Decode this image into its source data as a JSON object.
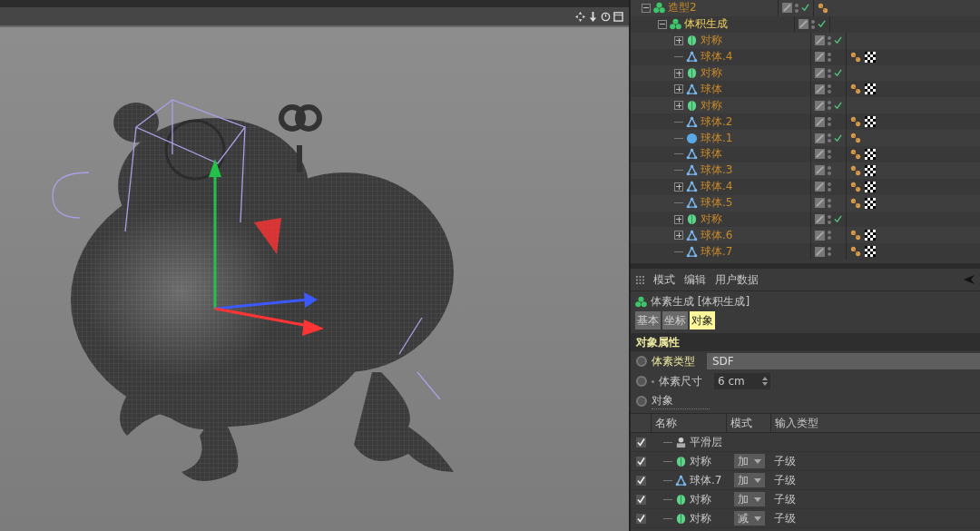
{
  "object_manager": {
    "tree": [
      {
        "name": "造型2",
        "kind": "cloner",
        "expanded": true,
        "enabled": true,
        "selected": false,
        "phong_tag": true,
        "texture_tag": false,
        "children": [
          {
            "name": "体积生成",
            "kind": "cloner",
            "expanded": true,
            "enabled": true,
            "selected": true,
            "phong_tag": false,
            "texture_tag": false,
            "children": [
              {
                "name": "对称",
                "kind": "symmetry",
                "expanded": false,
                "enabled": true,
                "selected": false,
                "phong_tag": false,
                "texture_tag": false
              },
              {
                "name": "球体.4",
                "kind": "polygon",
                "enabled": false,
                "selected": false,
                "phong_tag": true,
                "texture_tag": true
              },
              {
                "name": "对称",
                "kind": "symmetry",
                "expanded": false,
                "enabled": true,
                "selected": false,
                "phong_tag": false,
                "texture_tag": false
              },
              {
                "name": "球体",
                "kind": "polygon",
                "expanded": false,
                "enabled": false,
                "selected": false,
                "phong_tag": true,
                "texture_tag": true
              },
              {
                "name": "对称",
                "kind": "symmetry",
                "expanded": false,
                "enabled": true,
                "selected": false,
                "phong_tag": false,
                "texture_tag": false
              },
              {
                "name": "球体.2",
                "kind": "polygon",
                "enabled": false,
                "selected": false,
                "phong_tag": true,
                "texture_tag": true
              },
              {
                "name": "球体.1",
                "kind": "sphere",
                "enabled": true,
                "selected": false,
                "phong_tag": true,
                "texture_tag": false
              },
              {
                "name": "球体",
                "kind": "polygon",
                "enabled": false,
                "selected": false,
                "phong_tag": true,
                "texture_tag": true
              },
              {
                "name": "球体.3",
                "kind": "polygon",
                "enabled": false,
                "selected": false,
                "phong_tag": true,
                "texture_tag": true
              },
              {
                "name": "球体.4",
                "kind": "polygon",
                "expanded": false,
                "enabled": false,
                "selected": false,
                "phong_tag": true,
                "texture_tag": true
              },
              {
                "name": "球体.5",
                "kind": "polygon",
                "enabled": false,
                "selected": false,
                "phong_tag": true,
                "texture_tag": true
              },
              {
                "name": "对称",
                "kind": "symmetry",
                "expanded": false,
                "enabled": true,
                "selected": false,
                "phong_tag": false,
                "texture_tag": false
              },
              {
                "name": "球体.6",
                "kind": "polygon",
                "expanded": false,
                "enabled": false,
                "selected": false,
                "phong_tag": true,
                "texture_tag": true
              },
              {
                "name": "球体.7",
                "kind": "polygon",
                "enabled": false,
                "selected": false,
                "phong_tag": true,
                "texture_tag": true
              }
            ]
          }
        ]
      }
    ]
  },
  "attributes": {
    "menu": [
      "模式",
      "编辑",
      "用户数据"
    ],
    "object_title": "体素生成 [体积生成]",
    "tabs": [
      {
        "label": "基本",
        "selected": false
      },
      {
        "label": "坐标",
        "selected": false
      },
      {
        "label": "对象",
        "selected": true
      }
    ],
    "section": "对象属性",
    "fields": [
      {
        "kind": "dropdown",
        "label": "体素类型",
        "value": "SDF",
        "keyframed": false
      },
      {
        "kind": "spinner",
        "label": "体素尺寸",
        "value": "6 cm",
        "keyframed": false
      },
      {
        "kind": "list",
        "label": "对象",
        "keyframed": false
      }
    ],
    "table": {
      "columns": [
        "名称",
        "模式",
        "输入类型"
      ],
      "rows": [
        {
          "checked": true,
          "kind": "smooth",
          "name": "平滑层"
        },
        {
          "checked": true,
          "kind": "symmetry",
          "name": "对称",
          "mode": "加",
          "input_type": "子级"
        },
        {
          "checked": true,
          "kind": "polygon",
          "name": "球体.7",
          "mode": "加",
          "input_type": "子级"
        },
        {
          "checked": true,
          "kind": "symmetry",
          "name": "对称",
          "mode": "加",
          "input_type": "子级"
        },
        {
          "checked": true,
          "kind": "symmetry",
          "name": "对称",
          "mode": "减",
          "input_type": "子级"
        }
      ]
    }
  }
}
